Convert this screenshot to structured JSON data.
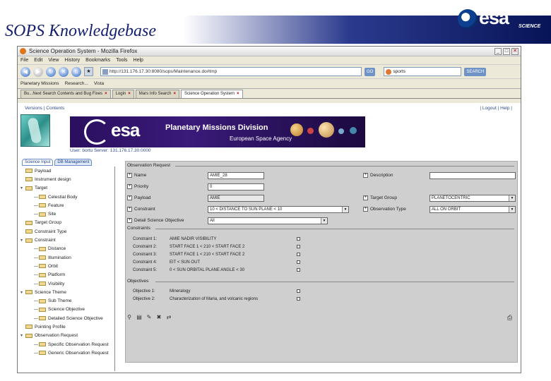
{
  "slide": {
    "title": "SOPS Knowledgebase",
    "logo_word": "esa",
    "logo_sub": "SCIENCE"
  },
  "browser": {
    "window_title": "Science Operation System - Mozilla Firefox",
    "menu": [
      "File",
      "Edit",
      "View",
      "History",
      "Bookmarks",
      "Tools",
      "Help"
    ],
    "url": "http://131.176.17.30:8080/sops/Maintenance.do#tmp",
    "go_label": "GO",
    "search_value": "sports",
    "search_label": "SEARCH",
    "bookmarks": [
      "Planetary Missions",
      "Research...",
      "Vista"
    ],
    "tabs": [
      {
        "label": "Bu...Next Search Contents and Bug Fixes",
        "active": false
      },
      {
        "label": "Login",
        "active": false
      },
      {
        "label": "Mars Info Search",
        "active": false
      },
      {
        "label": "Science Operation System",
        "active": true
      }
    ]
  },
  "app": {
    "top_left": [
      "Versions",
      "Contents"
    ],
    "top_right": [
      "Logout",
      "Help"
    ],
    "banner": {
      "logo": "esa",
      "title": "Planetary Missions Division",
      "subtitle": "European Space Agency"
    },
    "user_info": "User: bortu   Server: 131.176.17.30:0000",
    "nav_tabs": [
      {
        "label": "Science Input",
        "active": false
      },
      {
        "label": "DB Management",
        "active": true
      }
    ],
    "tree": [
      {
        "label": "Payload",
        "level": 0,
        "expander": ""
      },
      {
        "label": "Instrument design",
        "level": 0,
        "expander": ""
      },
      {
        "label": "Target",
        "level": 0,
        "expander": "▾"
      },
      {
        "label": "Celestial Body",
        "level": 1,
        "expander": ""
      },
      {
        "label": "Feature",
        "level": 1,
        "expander": ""
      },
      {
        "label": "Site",
        "level": 1,
        "expander": ""
      },
      {
        "label": "Target Group",
        "level": 0,
        "expander": ""
      },
      {
        "label": "Constraint Type",
        "level": 0,
        "expander": ""
      },
      {
        "label": "Constraint",
        "level": 0,
        "expander": "▾"
      },
      {
        "label": "Distance",
        "level": 1,
        "expander": ""
      },
      {
        "label": "Illumination",
        "level": 1,
        "expander": ""
      },
      {
        "label": "Orbit",
        "level": 1,
        "expander": ""
      },
      {
        "label": "Platform",
        "level": 1,
        "expander": ""
      },
      {
        "label": "Visibility",
        "level": 1,
        "expander": ""
      },
      {
        "label": "Science Theme",
        "level": 0,
        "expander": "▾"
      },
      {
        "label": "Sub Theme",
        "level": 1,
        "expander": ""
      },
      {
        "label": "Science Objective",
        "level": 1,
        "expander": ""
      },
      {
        "label": "Detailed Science Objective",
        "level": 1,
        "expander": ""
      },
      {
        "label": "Pointing Profile",
        "level": 0,
        "expander": ""
      },
      {
        "label": "Observation Request",
        "level": 0,
        "expander": "▾"
      },
      {
        "label": "Specific Observation Request",
        "level": 1,
        "expander": ""
      },
      {
        "label": "Generic Observation Request",
        "level": 1,
        "expander": ""
      }
    ],
    "form": {
      "section_title": "Observation Request",
      "fields_left": [
        {
          "label": "Name",
          "value": "AMIE_28",
          "kind": "input"
        },
        {
          "label": "Priority",
          "value": "0",
          "kind": "input"
        },
        {
          "label": "Payload",
          "value": "AMIE",
          "kind": "grey"
        },
        {
          "label": "Constraint",
          "value": "10 < DISTANCE TO SUN PLANE < 10",
          "kind": "select"
        },
        {
          "label": "Detail Science Objective",
          "value": "All",
          "kind": "select"
        }
      ],
      "fields_right": [
        {
          "label": "Description",
          "value": "",
          "kind": "input"
        },
        {
          "label": "Target Group",
          "value": "PLANETOCENTRIC",
          "kind": "select"
        },
        {
          "label": "Observation Type",
          "value": "ALL ON ORBIT",
          "kind": "select"
        }
      ],
      "constraints_title": "Constraints",
      "constraints": [
        {
          "name": "Constraint 1:",
          "value": "AMIE NADIR VISIBILITY"
        },
        {
          "name": "Constraint 2:",
          "value": "START FACE 1 < 210 < START FACE 2"
        },
        {
          "name": "Constraint 3:",
          "value": "START FACE 1 < 210 < START FACE 2"
        },
        {
          "name": "Constraint 4:",
          "value": "EIT < SUN OUT"
        },
        {
          "name": "Constraint 5:",
          "value": "0 < SUN ORBITAL PLANE ANGLE < 30"
        }
      ],
      "objectives_title": "Objectives",
      "objectives": [
        {
          "name": "Objective 1:",
          "value": "Mineralogy"
        },
        {
          "name": "Objective 2:",
          "value": "Characterization of Maria, and volcanic regions"
        }
      ]
    }
  }
}
